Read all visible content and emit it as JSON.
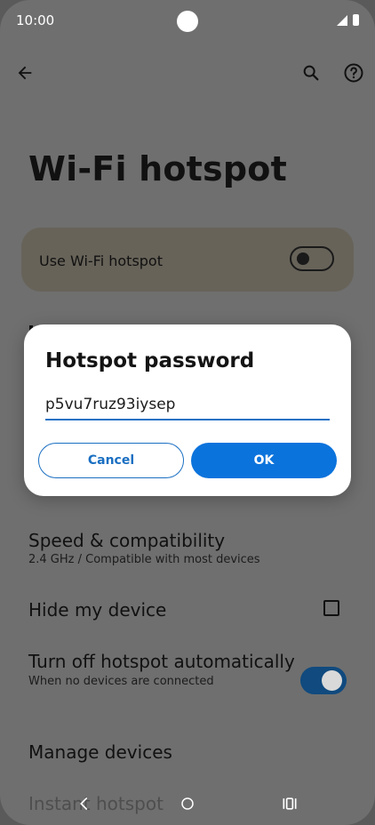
{
  "status": {
    "time": "10:00"
  },
  "page": {
    "title": "Wi-Fi hotspot"
  },
  "toggle_card": {
    "label": "Use Wi-Fi hotspot",
    "state": "off"
  },
  "rows": {
    "speed": {
      "title": "Speed & compatibility",
      "subtitle": "2.4 GHz / Compatible with most devices"
    },
    "hide": {
      "title": "Hide my device",
      "checked": false
    },
    "turn_off": {
      "title": "Turn off hotspot automatically",
      "subtitle": "When no devices are connected",
      "state": "on"
    },
    "manage": {
      "title": "Manage devices"
    },
    "instant": {
      "title": "Instant hotspot"
    }
  },
  "dialog": {
    "title": "Hotspot password",
    "input_value": "p5vu7ruz93iysep",
    "cancel_label": "Cancel",
    "ok_label": "OK"
  },
  "colors": {
    "accent": "#0b73dc",
    "switch_on": "#104a7e",
    "scrim": "#6f6f6f"
  },
  "icons": {
    "back": "arrow-left-icon",
    "search": "search-icon",
    "help": "help-circle-icon",
    "nav_back": "chevron-left-icon",
    "nav_home": "circle-home-icon",
    "nav_recents": "recents-icon"
  }
}
